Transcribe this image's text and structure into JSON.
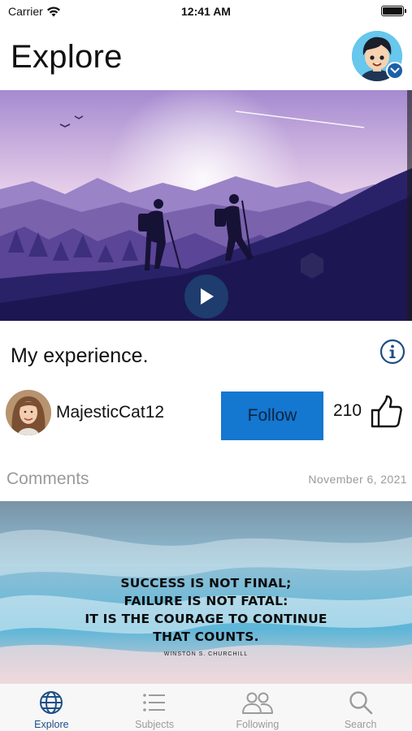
{
  "status_bar": {
    "carrier": "Carrier",
    "time": "12:41 AM"
  },
  "header": {
    "title": "Explore"
  },
  "post": {
    "title": "My experience.",
    "author": "MajesticCat12",
    "follow_label": "Follow",
    "like_count": "210",
    "comments_label": "Comments",
    "date": "November 6, 2021"
  },
  "quote": {
    "lines": [
      "SUCCESS IS NOT FINAL;",
      "FAILURE IS NOT FATAL:",
      "IT IS THE COURAGE TO CONTINUE",
      "THAT COUNTS."
    ],
    "author": "WINSTON S. CHURCHILL"
  },
  "tabs": [
    {
      "label": "Explore",
      "icon": "globe-icon",
      "active": true
    },
    {
      "label": "Subjects",
      "icon": "list-icon",
      "active": false
    },
    {
      "label": "Following",
      "icon": "people-icon",
      "active": false
    },
    {
      "label": "Search",
      "icon": "search-icon",
      "active": false
    }
  ],
  "colors": {
    "accent": "#1e4e86",
    "follow_button": "#1477d0",
    "muted": "#9a9a9a"
  }
}
